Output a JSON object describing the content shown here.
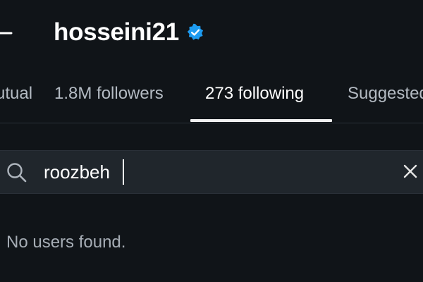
{
  "header": {
    "title": "hosseini21",
    "back_icon": "back-arrow-icon",
    "verified_icon": "verified-badge-icon",
    "verified_color": "#1d9bf0"
  },
  "tabs": [
    {
      "label": "Mutual",
      "active": false
    },
    {
      "label": "1.8M followers",
      "active": false
    },
    {
      "label": "273 following",
      "active": true
    },
    {
      "label": "Suggested",
      "active": false
    }
  ],
  "search": {
    "value": "roozbeh",
    "search_icon": "search-icon",
    "clear_icon": "close-icon"
  },
  "results": {
    "empty_message": "No users found."
  }
}
